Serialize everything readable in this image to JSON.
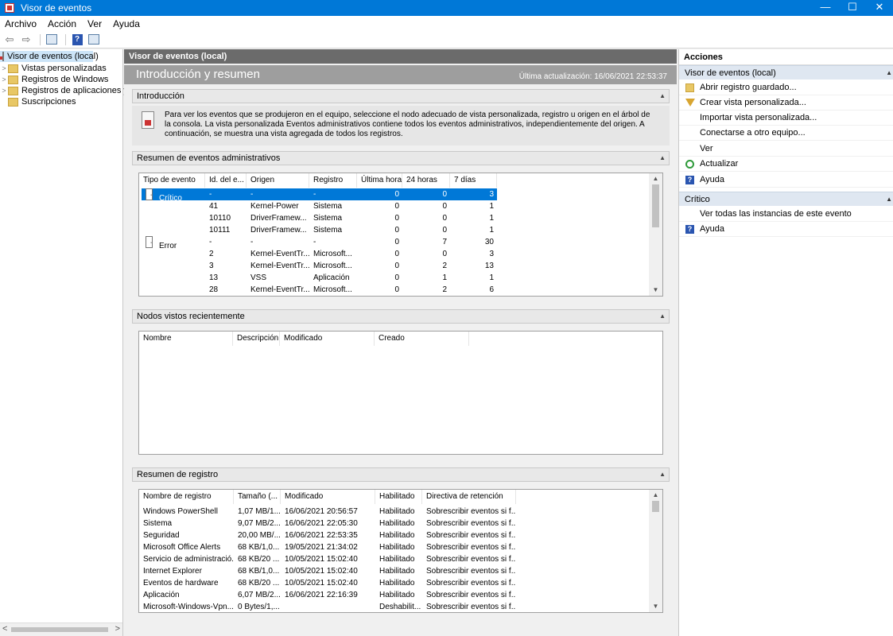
{
  "window": {
    "title": "Visor de eventos",
    "minimize": "—",
    "maximize": "☐",
    "close": "✕"
  },
  "menu": [
    "Archivo",
    "Acción",
    "Ver",
    "Ayuda"
  ],
  "toolbar": {
    "back": "⇦",
    "forward": "⇨",
    "help": "?"
  },
  "tree": {
    "items": [
      {
        "label": "Visor de eventos (local)"
      },
      {
        "label": "Vistas personalizadas"
      },
      {
        "label": "Registros de Windows"
      },
      {
        "label": "Registros de aplicaciones y s"
      },
      {
        "label": "Suscripciones"
      }
    ],
    "scroll_left": "<",
    "scroll_right": ">"
  },
  "center": {
    "header": "Visor de eventos (local)",
    "banner_title": "Introducción y resumen",
    "last_update": "Última actualización: 16/06/2021 22:53:37",
    "collapse": "▲",
    "intro": {
      "title": "Introducción",
      "text": "Para ver los eventos que se produjeron en el equipo, seleccione el nodo adecuado de vista personalizada, registro u origen en el árbol de la consola. La vista personalizada Eventos administrativos contiene todos los eventos administrativos, independientemente del origen. A continuación, se muestra una vista agregada de todos los registros."
    },
    "admin_summary": {
      "title": "Resumen de eventos administrativos",
      "columns": [
        "Tipo de evento",
        "Id. del e...",
        "Origen",
        "Registro",
        "Última hora",
        "24 horas",
        "7 días"
      ],
      "rows": [
        {
          "type": "Crítico",
          "id": "-",
          "source": "-",
          "log": "-",
          "h1": "0",
          "h24": "0",
          "d7": "3",
          "expander": "−"
        },
        {
          "type": "",
          "id": "41",
          "source": "Kernel-Power",
          "log": "Sistema",
          "h1": "0",
          "h24": "0",
          "d7": "1"
        },
        {
          "type": "",
          "id": "10110",
          "source": "DriverFramew...",
          "log": "Sistema",
          "h1": "0",
          "h24": "0",
          "d7": "1"
        },
        {
          "type": "",
          "id": "10111",
          "source": "DriverFramew...",
          "log": "Sistema",
          "h1": "0",
          "h24": "0",
          "d7": "1"
        },
        {
          "type": "Error",
          "id": "-",
          "source": "-",
          "log": "-",
          "h1": "0",
          "h24": "7",
          "d7": "30",
          "expander": "−"
        },
        {
          "type": "",
          "id": "2",
          "source": "Kernel-EventTr...",
          "log": "Microsoft...",
          "h1": "0",
          "h24": "0",
          "d7": "3"
        },
        {
          "type": "",
          "id": "3",
          "source": "Kernel-EventTr...",
          "log": "Microsoft...",
          "h1": "0",
          "h24": "2",
          "d7": "13"
        },
        {
          "type": "",
          "id": "13",
          "source": "VSS",
          "log": "Aplicación",
          "h1": "0",
          "h24": "1",
          "d7": "1"
        },
        {
          "type": "",
          "id": "28",
          "source": "Kernel-EventTr...",
          "log": "Microsoft...",
          "h1": "0",
          "h24": "2",
          "d7": "6"
        }
      ]
    },
    "recent_nodes": {
      "title": "Nodos vistos recientemente",
      "columns": [
        "Nombre",
        "Descripción",
        "Modificado",
        "Creado"
      ]
    },
    "log_summary": {
      "title": "Resumen de registro",
      "columns": [
        "Nombre de registro",
        "Tamaño (...",
        "Modificado",
        "Habilitado",
        "Directiva de retención"
      ],
      "rows": [
        [
          "Windows PowerShell",
          "1,07 MB/1...",
          "16/06/2021 20:56:57",
          "Habilitado",
          "Sobrescribir eventos si f..."
        ],
        [
          "Sistema",
          "9,07 MB/2...",
          "16/06/2021 22:05:30",
          "Habilitado",
          "Sobrescribir eventos si f..."
        ],
        [
          "Seguridad",
          "20,00 MB/...",
          "16/06/2021 22:53:35",
          "Habilitado",
          "Sobrescribir eventos si f..."
        ],
        [
          "Microsoft Office Alerts",
          "68 KB/1,0...",
          "19/05/2021 21:34:02",
          "Habilitado",
          "Sobrescribir eventos si f..."
        ],
        [
          "Servicio de administració...",
          "68 KB/20 ...",
          "10/05/2021 15:02:40",
          "Habilitado",
          "Sobrescribir eventos si f..."
        ],
        [
          "Internet Explorer",
          "68 KB/1,0...",
          "10/05/2021 15:02:40",
          "Habilitado",
          "Sobrescribir eventos si f..."
        ],
        [
          "Eventos de hardware",
          "68 KB/20 ...",
          "10/05/2021 15:02:40",
          "Habilitado",
          "Sobrescribir eventos si f..."
        ],
        [
          "Aplicación",
          "6,07 MB/2...",
          "16/06/2021 22:16:39",
          "Habilitado",
          "Sobrescribir eventos si f..."
        ],
        [
          "Microsoft-Windows-Vpn...",
          "0 Bytes/1,...",
          "",
          "Deshabilit...",
          "Sobrescribir eventos si f..."
        ]
      ]
    },
    "scroll_up": "▲",
    "scroll_down": "▼"
  },
  "actions": {
    "title": "Acciones",
    "section1": {
      "title": "Visor de eventos (local)",
      "items": [
        {
          "label": "Abrir registro guardado...",
          "icon": "open-folder"
        },
        {
          "label": "Crear vista personalizada...",
          "icon": "filter"
        },
        {
          "label": "Importar vista personalizada...",
          "icon": ""
        },
        {
          "label": "Conectarse a otro equipo...",
          "icon": ""
        },
        {
          "label": "Ver",
          "icon": ""
        },
        {
          "label": "Actualizar",
          "icon": "refresh"
        },
        {
          "label": "Ayuda",
          "icon": "help"
        }
      ]
    },
    "section2": {
      "title": "Crítico",
      "items": [
        {
          "label": "Ver todas las instancias de este evento",
          "icon": ""
        },
        {
          "label": "Ayuda",
          "icon": "help"
        }
      ]
    },
    "expand_icon": "▲"
  }
}
